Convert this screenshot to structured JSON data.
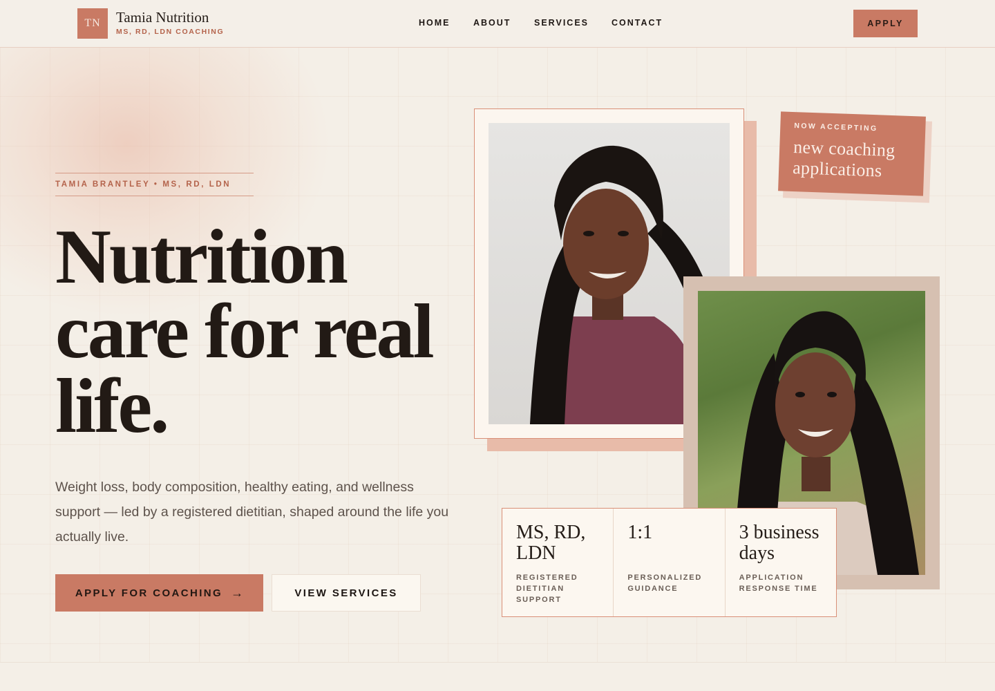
{
  "header": {
    "logo_initials": "TN",
    "brand_name": "Tamia Nutrition",
    "brand_subtitle": "MS, RD, LDN COACHING",
    "nav": [
      {
        "label": "HOME"
      },
      {
        "label": "ABOUT"
      },
      {
        "label": "SERVICES"
      },
      {
        "label": "CONTACT"
      }
    ],
    "apply_label": "APPLY"
  },
  "hero": {
    "eyebrow": "TAMIA BRANTLEY • MS, RD, LDN",
    "headline_lines": [
      "Nutrition",
      "care for real",
      "life."
    ],
    "lede": "Weight loss, body composition, healthy eating, and wellness support — led by a registered dietitian, shaped around the life you actually live.",
    "cta_primary": "APPLY FOR COACHING",
    "cta_primary_arrow": "→",
    "cta_secondary": "VIEW SERVICES"
  },
  "badge": {
    "eyebrow": "NOW ACCEPTING",
    "text": "new coaching applications"
  },
  "stats": [
    {
      "value": "MS, RD, LDN",
      "label": "REGISTERED DIETITIAN SUPPORT"
    },
    {
      "value": "1:1",
      "label": "PERSONALIZED GUIDANCE"
    },
    {
      "value": "3 business days",
      "label": "APPLICATION RESPONSE TIME"
    }
  ],
  "colors": {
    "accent": "#c97a64",
    "accent_text": "#b4634b",
    "background": "#f4efe7",
    "ink": "#221a15"
  }
}
